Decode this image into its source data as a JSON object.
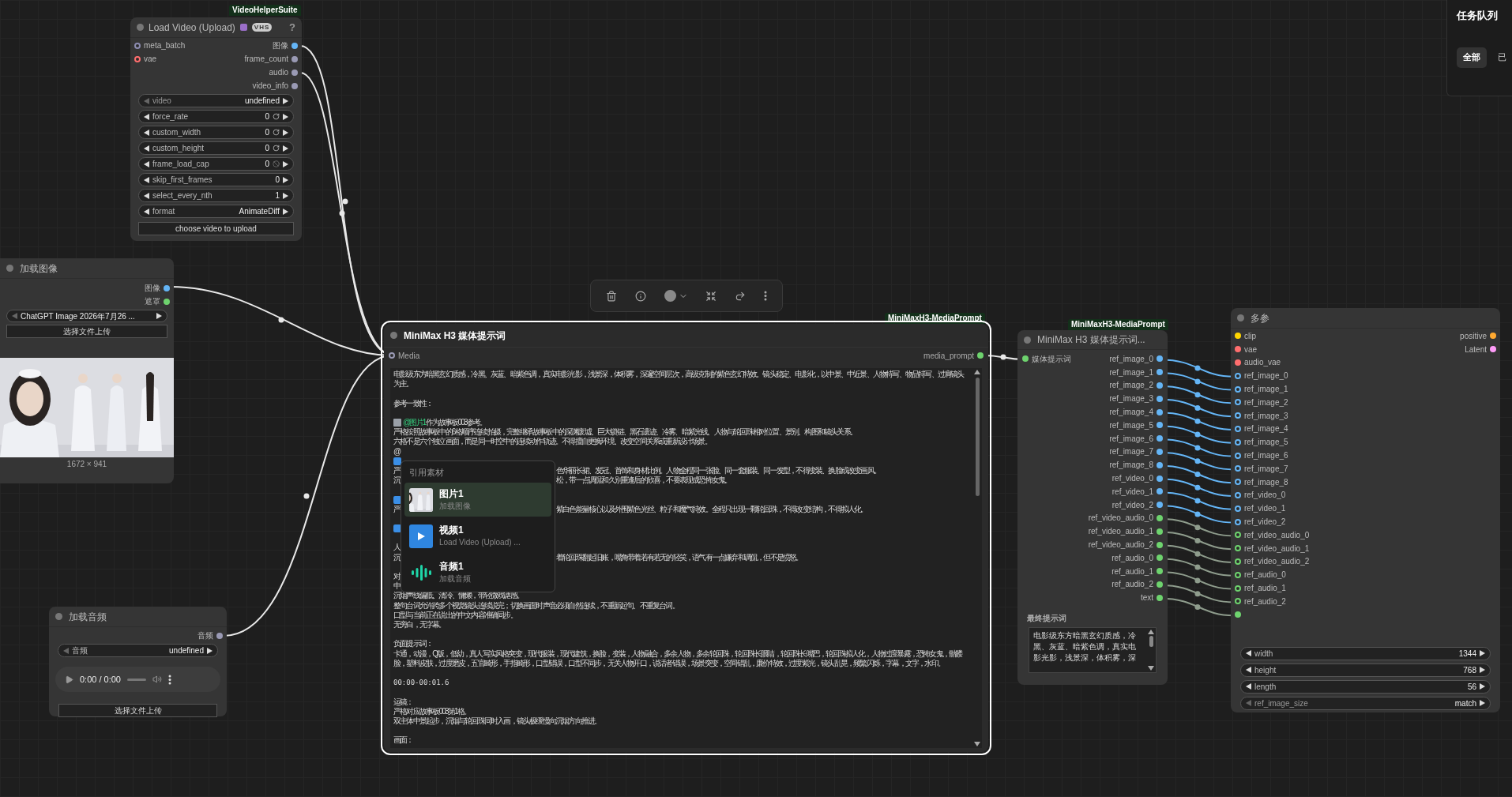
{
  "queue_panel": {
    "title": "任务队列",
    "tabs": [
      {
        "label": "全部",
        "selected": true
      },
      {
        "label": "已",
        "selected": false
      }
    ]
  },
  "load_video": {
    "source": "VideoHelperSuite",
    "title": "Load Video (Upload)",
    "badge": "VHS",
    "help": "?",
    "selected": false,
    "inputs": [
      {
        "label": "meta_batch",
        "color": "#8c8cb0",
        "optional": true
      },
      {
        "label": "vae",
        "color": "#ff6e6e",
        "optional": true
      }
    ],
    "outputs": [
      {
        "label": "图像",
        "color": "#64b5f6"
      },
      {
        "label": "frame_count",
        "color": "#9a9ab4"
      },
      {
        "label": "audio",
        "color": "#9a9ab4"
      },
      {
        "label": "video_info",
        "color": "#9a9ab4"
      }
    ],
    "widgets": [
      {
        "label": "video",
        "value": "undefined",
        "at_start": true
      },
      {
        "label": "force_rate",
        "value": "0",
        "at_start": false,
        "kind": "reset"
      },
      {
        "label": "custom_width",
        "value": "0",
        "at_start": false,
        "kind": "reset"
      },
      {
        "label": "custom_height",
        "value": "0",
        "at_start": false,
        "kind": "reset"
      },
      {
        "label": "frame_load_cap",
        "value": "0",
        "at_start": false,
        "kind": "blocked"
      },
      {
        "label": "skip_first_frames",
        "value": "0",
        "at_start": false
      },
      {
        "label": "select_every_nth",
        "value": "1",
        "at_start": false
      },
      {
        "label": "format",
        "value": "AnimateDiff",
        "at_start": false
      }
    ],
    "upload_button": "choose video to upload"
  },
  "load_image": {
    "title": "加载图像",
    "selected": false,
    "outputs": [
      {
        "label": "图像",
        "color": "#64b5f6"
      },
      {
        "label": "遮罩",
        "color": "#6ed36e"
      }
    ],
    "file": {
      "value": "ChatGPT Image 2026年7月26  ...",
      "at_start": true
    },
    "upload_button": "选择文件上传",
    "image_size": "1672 × 941"
  },
  "load_audio": {
    "title": "加载音频",
    "selected": false,
    "outputs": [
      {
        "label": "音频",
        "color": "#9a9ab4"
      }
    ],
    "file": {
      "label": "音频",
      "value": "undefined",
      "at_start": true
    },
    "player_time": "0:00 / 0:00",
    "upload_button": "选择文件上传"
  },
  "media_prompt": {
    "source": "MiniMaxH3-MediaPrompt",
    "title": "MiniMax H3 媒体提示词",
    "selected": true,
    "input": {
      "label": "Media",
      "color": "#9a9ab4",
      "optional": true
    },
    "output": {
      "label": "media_prompt",
      "color": "#6ed36e"
    },
    "lines": [
      {
        "kind": "text",
        "text": "电影级东方暗黑玄幻质感，冷黑、灰蓝、暗紫色调，真实电影光影，浅景深，体积雾，深邃空间层次，高级克制的紫色玄幻特效。镜头稳定、电影化，以中景、中近景、人物特写、物品特写、过肩镜头为主。"
      },
      {
        "kind": "blank"
      },
      {
        "kind": "text",
        "text": "参考一致性："
      },
      {
        "kind": "blank"
      },
      {
        "kind": "ref",
        "tag": "@图片1",
        "text": "作为故事板003参考。"
      },
      {
        "kind": "text",
        "text": "严格按照故事板中的6格顺序连续拍摄，完整继承故事板中的深渊废墟、巨大锁链、黑石遗迹、冷雾、暗紫光线、人物与轮回珠相对位置、景别、构图和镜头关系。"
      },
      {
        "kind": "text",
        "text": "六格不是六个独立画面，而是同一时空中的连续动作轨迹。不得擅自更换环境、改变空间关系或重新设计场景。"
      },
      {
        "kind": "edge",
        "left": "@"
      },
      {
        "kind": "thumb"
      },
      {
        "kind": "split",
        "left": "严",
        "right": "色华丽长裙、发冠、首饰和身材比例。人物全程同一张脸、同一套服装、同一发型，不得变装、换脸或改变画风。"
      },
      {
        "kind": "split",
        "left": "沉",
        "right": "松，带一点调侃和久别重逢后的欣喜，不要表现成恐怖女鬼。"
      },
      {
        "kind": "blank"
      },
      {
        "kind": "thumb"
      },
      {
        "kind": "split",
        "left": "严",
        "right": "紫白色能量核心以及外围紫色光丝、粒子和魔气特效。全程只出现一颗轮回珠，不得改变结构，不得拟人化。"
      },
      {
        "kind": "blank"
      },
      {
        "kind": "thumb"
      },
      {
        "kind": "blank"
      },
      {
        "kind": "edge",
        "left": "人"
      },
      {
        "kind": "split",
        "left": "沉",
        "right": "着轮回珠翻起旧账，嘴角带着若有若无的轻笑，语气有一点嫌弃和调侃，但不是愤怒。"
      },
      {
        "kind": "blank"
      },
      {
        "kind": "edge",
        "left": "对"
      },
      {
        "kind": "edge",
        "left": "中"
      },
      {
        "kind": "text",
        "text": "沉烟声线偏低、清冷、慵懒，带轻微戏谑感。"
      },
      {
        "kind": "text",
        "text": "整句台词允许跨多个视觉镜头连续说完；切换画面时声音必须自然连续，不重新起句、不重复台词。"
      },
      {
        "kind": "text",
        "text": "口型与当前正在说出的中文内容准确同步。"
      },
      {
        "kind": "text",
        "text": "无旁白，无字幕。"
      },
      {
        "kind": "blank"
      },
      {
        "kind": "text",
        "text": "负面提示词："
      },
      {
        "kind": "text",
        "text": "卡通，动漫，Q版，低幼，真人写实风格突变，现代服装，现代建筑，换脸，变装，人物融合，多余人物，多余轮回珠，轮回珠长眼睛，轮回珠长嘴巴，轮回珠拟人化，人物过度暴露，恐怖女鬼，骷髅脸，塑料皮肤，过度磨皮，五官畸形，手指畸形，口型错误，口型不同步，无关人物开口，说话者错误，场景突变，空间错乱，廉价特效，过度紫光，镜头乱晃，频繁闪烁，字幕，文字，水印。"
      },
      {
        "kind": "blank"
      },
      {
        "kind": "mono",
        "text": "00:00-00:01.6"
      },
      {
        "kind": "blank"
      },
      {
        "kind": "text",
        "text": "运镜："
      },
      {
        "kind": "text",
        "text": "严格对应故事板003第1格。"
      },
      {
        "kind": "text",
        "text": "双主体中景起步，沉烟与轮回珠同时入画，镜头极缓慢向沉烟方向推进。"
      },
      {
        "kind": "blank"
      },
      {
        "kind": "text",
        "text": "画面："
      }
    ]
  },
  "mention_menu": {
    "title": "引用素材",
    "items": [
      {
        "title": "图片1",
        "subtitle": "加载图像",
        "selected": true
      },
      {
        "kind": "video",
        "title": "视频1",
        "subtitle": "Load Video (Upload) ...",
        "selected": false
      },
      {
        "kind": "audio",
        "title": "音频1",
        "subtitle": "加载音频",
        "selected": false
      }
    ]
  },
  "prompt_node": {
    "source": "MiniMaxH3-MediaPrompt",
    "title": "MiniMax H3 媒体提示词...",
    "selected": false,
    "input": {
      "label": "媒体提示词",
      "color": "#6ed36e"
    },
    "outputs": [
      {
        "label": "ref_image_0",
        "color": "#64b5f6"
      },
      {
        "label": "ref_image_1",
        "color": "#64b5f6"
      },
      {
        "label": "ref_image_2",
        "color": "#64b5f6"
      },
      {
        "label": "ref_image_3",
        "color": "#64b5f6"
      },
      {
        "label": "ref_image_4",
        "color": "#64b5f6"
      },
      {
        "label": "ref_image_5",
        "color": "#64b5f6"
      },
      {
        "label": "ref_image_6",
        "color": "#64b5f6"
      },
      {
        "label": "ref_image_7",
        "color": "#64b5f6"
      },
      {
        "label": "ref_image_8",
        "color": "#64b5f6"
      },
      {
        "label": "ref_video_0",
        "color": "#64b5f6"
      },
      {
        "label": "ref_video_1",
        "color": "#64b5f6"
      },
      {
        "label": "ref_video_2",
        "color": "#64b5f6"
      },
      {
        "label": "ref_video_audio_0",
        "color": "#6ed36e"
      },
      {
        "label": "ref_video_audio_1",
        "color": "#6ed36e"
      },
      {
        "label": "ref_video_audio_2",
        "color": "#6ed36e"
      },
      {
        "label": "ref_audio_0",
        "color": "#6ed36e"
      },
      {
        "label": "ref_audio_1",
        "color": "#6ed36e"
      },
      {
        "label": "ref_audio_2",
        "color": "#6ed36e"
      },
      {
        "label": "text",
        "color": "#6ed36e"
      }
    ],
    "final_label": "最终提示词",
    "final_text": "电影级东方暗黑玄幻质感，冷黑、灰蓝、暗紫色调，真实电影光影，浅景深，体积雾，深"
  },
  "multi_params": {
    "title": "多参",
    "selected": false,
    "inputs": [
      {
        "label": "clip",
        "color": "#ffd500",
        "optional": false
      },
      {
        "label": "vae",
        "color": "#ff6e6e",
        "optional": false
      },
      {
        "label": "audio_vae",
        "color": "#ff6e6e",
        "optional": false
      },
      {
        "label": "ref_image_0",
        "color": "#64b5f6",
        "optional": true
      },
      {
        "label": "ref_image_1",
        "color": "#64b5f6",
        "optional": true
      },
      {
        "label": "ref_image_2",
        "color": "#64b5f6",
        "optional": true
      },
      {
        "label": "ref_image_3",
        "color": "#64b5f6",
        "optional": true
      },
      {
        "label": "ref_image_4",
        "color": "#64b5f6",
        "optional": true
      },
      {
        "label": "ref_image_5",
        "color": "#64b5f6",
        "optional": true
      },
      {
        "label": "ref_image_6",
        "color": "#64b5f6",
        "optional": true
      },
      {
        "label": "ref_image_7",
        "color": "#64b5f6",
        "optional": true
      },
      {
        "label": "ref_image_8",
        "color": "#64b5f6",
        "optional": true
      },
      {
        "label": "ref_video_0",
        "color": "#64b5f6",
        "optional": true
      },
      {
        "label": "ref_video_1",
        "color": "#64b5f6",
        "optional": true
      },
      {
        "label": "ref_video_2",
        "color": "#64b5f6",
        "optional": true
      },
      {
        "label": "ref_video_audio_0",
        "color": "#6ed36e",
        "optional": true
      },
      {
        "label": "ref_video_audio_1",
        "color": "#6ed36e",
        "optional": true
      },
      {
        "label": "ref_video_audio_2",
        "color": "#6ed36e",
        "optional": true
      },
      {
        "label": "ref_audio_0",
        "color": "#6ed36e",
        "optional": true
      },
      {
        "label": "ref_audio_1",
        "color": "#6ed36e",
        "optional": true
      },
      {
        "label": "ref_audio_2",
        "color": "#6ed36e",
        "optional": true
      },
      {
        "color": "#6ed36e",
        "optional": false
      }
    ],
    "outputs": [
      {
        "label": "positive",
        "color": "#ffa931"
      },
      {
        "label": "Latent",
        "color": "#ff9cf9"
      }
    ],
    "widgets": [
      {
        "label": "width",
        "value": "1344",
        "at_start": false
      },
      {
        "label": "height",
        "value": "768",
        "at_start": false
      },
      {
        "label": "length",
        "value": "56",
        "at_start": false
      },
      {
        "label": "ref_image_size",
        "value": "match",
        "at_start": true
      }
    ]
  }
}
